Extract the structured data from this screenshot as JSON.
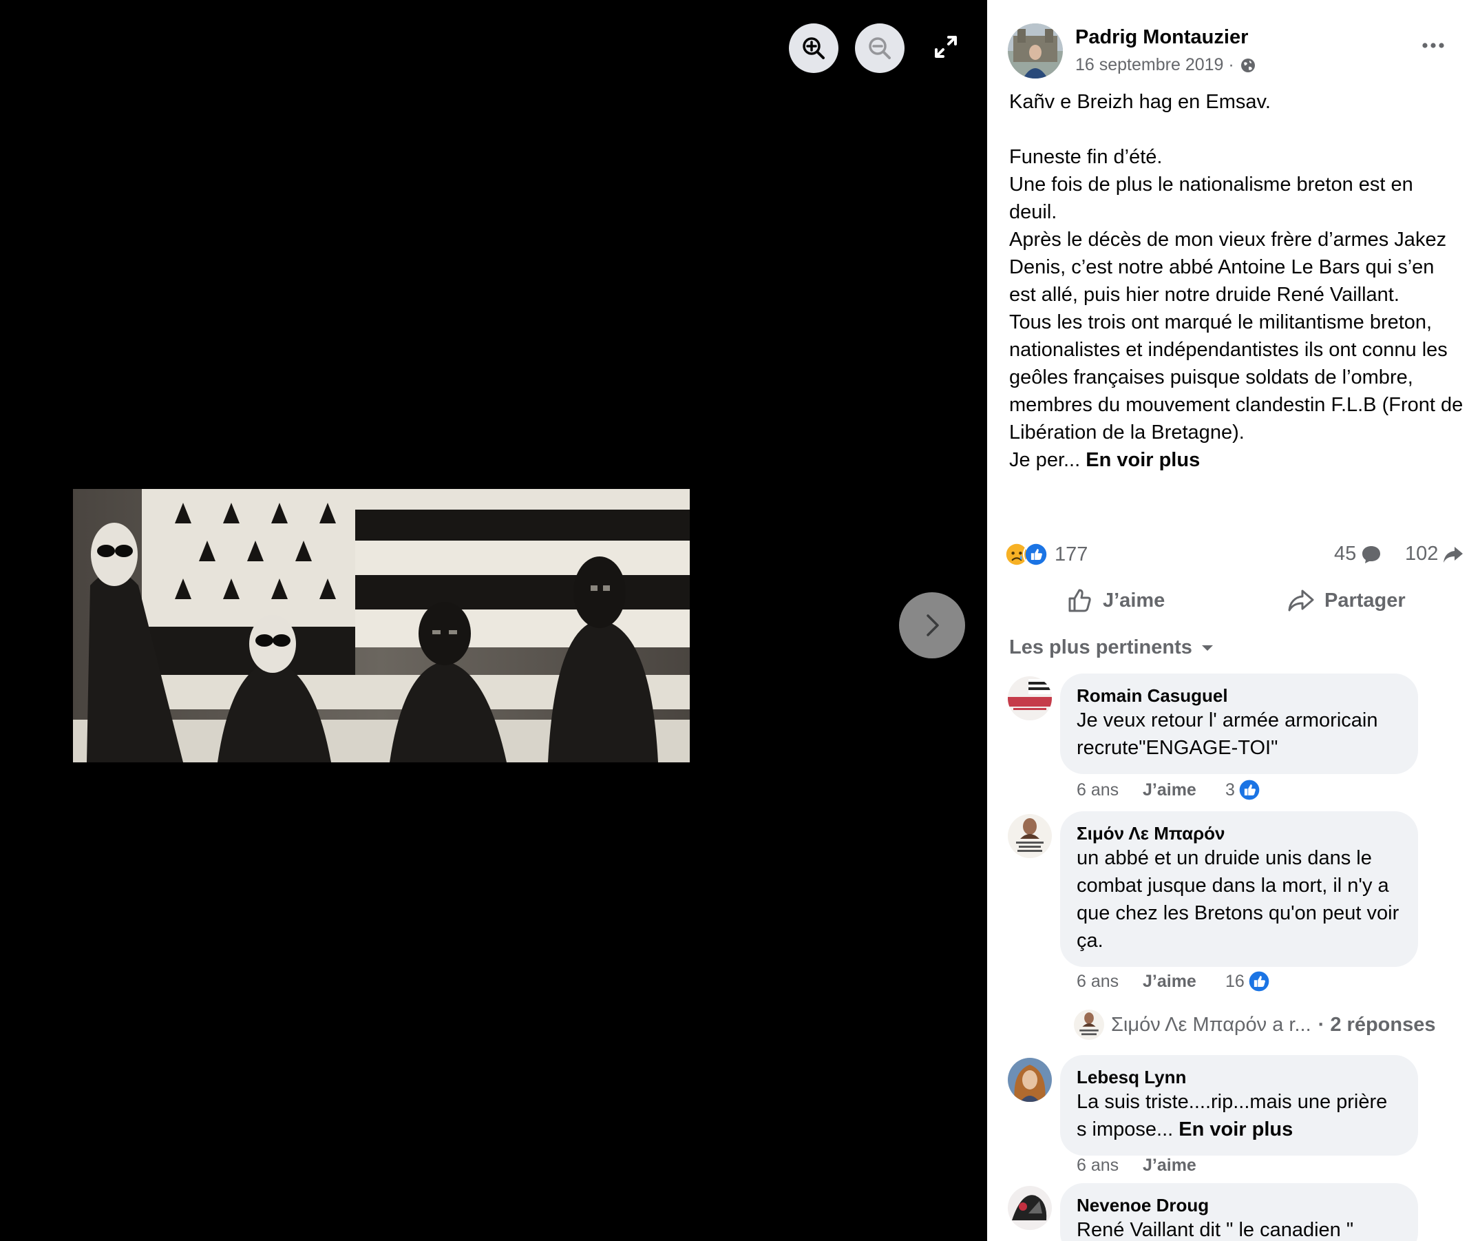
{
  "viewer": {
    "zoom_in_icon": "zoom-in-icon",
    "zoom_out_icon": "zoom-out-icon",
    "fullscreen_icon": "expand-icon",
    "next_icon": "chevron-right-icon"
  },
  "post": {
    "author": "Padrig Montauzier",
    "date": "16 septembre 2019 ·",
    "privacy_icon": "globe-icon",
    "lines": [
      "Kañv e Breizh hag en Emsav.",
      "",
      "Funeste fin d’été.",
      "Une fois de plus le nationalisme breton est en deuil.",
      "Après le décès de mon vieux frère d’armes Jakez Denis, c’est notre abbé Antoine Le Bars qui s’en est allé, puis hier notre druide René Vaillant.",
      "Tous les trois ont marqué le militantisme breton, nationalistes et indépendantistes ils ont connu les geôles françaises puisque soldats de l’ombre, membres du mouvement clandestin F.L.B (Front de Libération de la Bretagne)."
    ],
    "truncated": "Je per...",
    "see_more": "En voir plus",
    "reaction_count": "177",
    "comment_count": "45",
    "share_count": "102",
    "like_label": "J’aime",
    "share_label": "Partager",
    "sort_label": "Les plus pertinents"
  },
  "comments": [
    {
      "name": "Romain Casuguel",
      "text": "Je veux retour l' armée armoricain recrute\"ENGAGE-TOI\"",
      "ago": "6 ans",
      "like": "J’aime",
      "likes": "3"
    },
    {
      "name": "Σιμόν Λε Μπαρόν",
      "text": "un abbé et un druide unis dans le combat jusque dans la mort, il n'y a que chez les Bretons qu'on peut voir ça.",
      "ago": "6 ans",
      "like": "J’aime",
      "likes": "16"
    },
    {
      "name": "Lebesq Lynn",
      "text": "La suis triste....rip...mais une prière s impose...",
      "see_more": "En voir plus",
      "ago": "6 ans",
      "like": "J’aime",
      "likes": ""
    },
    {
      "name": "Nevenoe Droug",
      "text": "René Vaillant dit \" le canadien \""
    }
  ],
  "replies": {
    "author": "Σιμόν Λε Μπαρόν a r...",
    "count": "· 2 réponses"
  }
}
